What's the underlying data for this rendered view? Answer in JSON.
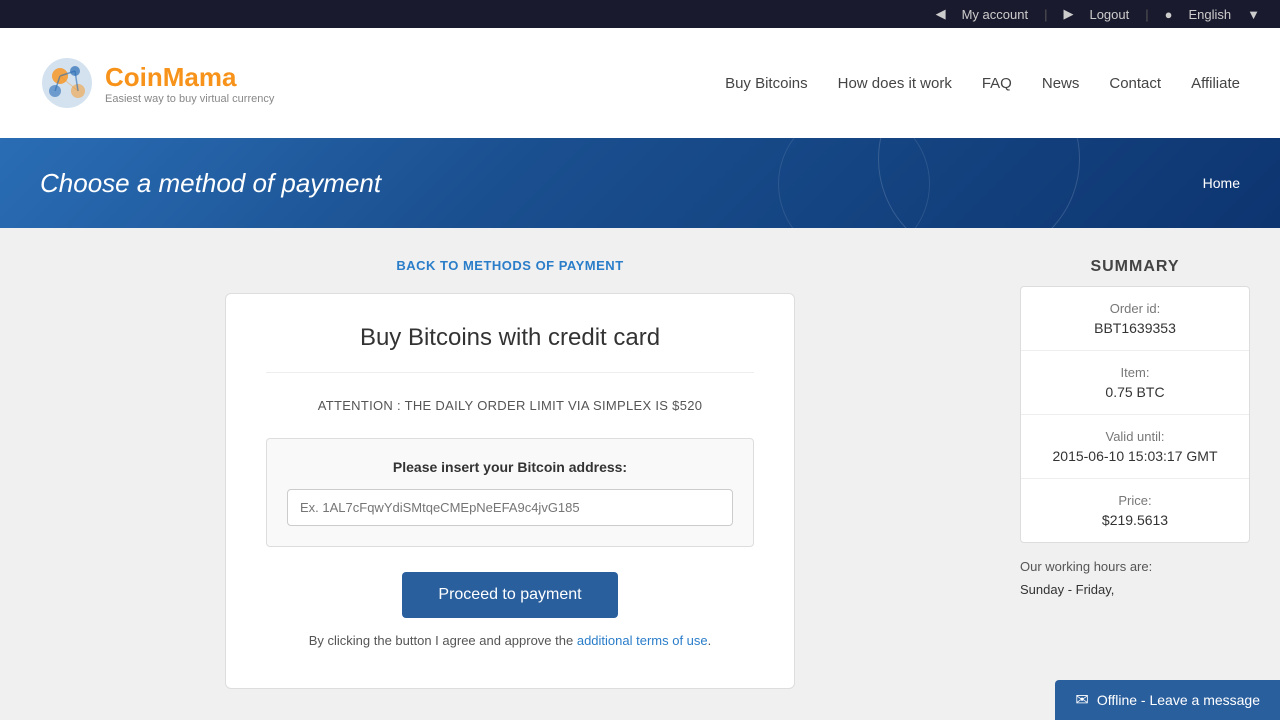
{
  "topbar": {
    "my_account": "My account",
    "logout": "Logout",
    "language": "English"
  },
  "header": {
    "logo_name_part1": "Coin",
    "logo_name_part2": "Mama",
    "logo_tagline": "Easiest way to buy virtual currency",
    "nav": {
      "buy_bitcoins": "Buy Bitcoins",
      "how_it_works": "How does it work",
      "faq": "FAQ",
      "news": "News",
      "contact": "Contact",
      "affiliate": "Affiliate"
    }
  },
  "hero": {
    "title": "Choose a method of payment",
    "breadcrumb": "Home"
  },
  "back_link": "BACK TO METHODS OF PAYMENT",
  "payment": {
    "heading": "Buy Bitcoins with credit card",
    "attention": "ATTENTION : THE DAILY ORDER LIMIT VIA SIMPLEX IS $520",
    "address_label": "Please insert your Bitcoin address:",
    "address_placeholder": "Ex. 1AL7cFqwYdiSMtqeCMEpNeEFA9c4jvG185",
    "proceed_btn": "Proceed to payment",
    "terms_text": "By clicking the button I agree and approve the ",
    "terms_link": "additional terms of use",
    "terms_end": "."
  },
  "summary": {
    "title": "SUMMARY",
    "order_id_label": "Order id:",
    "order_id_value": "BBT1639353",
    "item_label": "Item:",
    "item_value": "0.75 BTC",
    "valid_until_label": "Valid until:",
    "valid_until_value": "2015-06-10 15:03:17 GMT",
    "price_label": "Price:",
    "price_value": "$219.5613",
    "working_hours_title": "Our working hours are:",
    "hours_row": "Sunday - Friday,"
  },
  "offline_chat": {
    "label": "Offline - Leave a message"
  }
}
